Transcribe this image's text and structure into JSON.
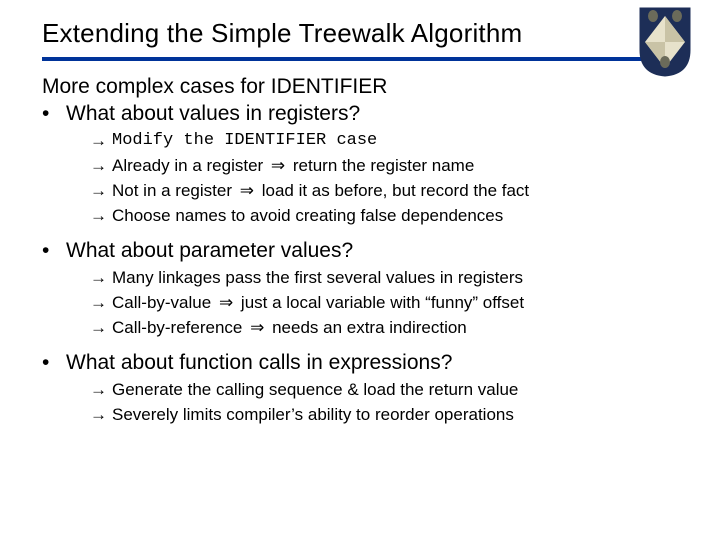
{
  "title": "Extending the Simple Treewalk Algorithm",
  "lead": "More complex cases for IDENTIFIER",
  "sections": [
    {
      "question": "What about values in registers?",
      "items": [
        {
          "pre": "Modify the ",
          "code": "IDENTIFIER",
          "post": " case",
          "mono": true
        },
        {
          "pre": "Already in a register ",
          "imp": "⇒",
          "post": " return the register name"
        },
        {
          "pre": "Not in a register ",
          "imp": "⇒",
          "post": " load it as before, but record the fact"
        },
        {
          "text": "Choose names to avoid creating false dependences"
        }
      ]
    },
    {
      "question": "What about parameter values?",
      "items": [
        {
          "text": "Many linkages pass the first several values in registers"
        },
        {
          "pre": "Call-by-value ",
          "imp": "⇒",
          "post": " just a local variable with “funny” offset"
        },
        {
          "pre": "Call-by-reference ",
          "imp": "⇒",
          "post": " needs an extra indirection"
        }
      ]
    },
    {
      "question": "What about function calls in expressions?",
      "items": [
        {
          "text": "Generate the calling sequence & load the return value"
        },
        {
          "text": "Severely limits compiler’s ability to reorder operations"
        }
      ]
    }
  ],
  "glyphs": {
    "dot": "•",
    "arrow": "→"
  }
}
